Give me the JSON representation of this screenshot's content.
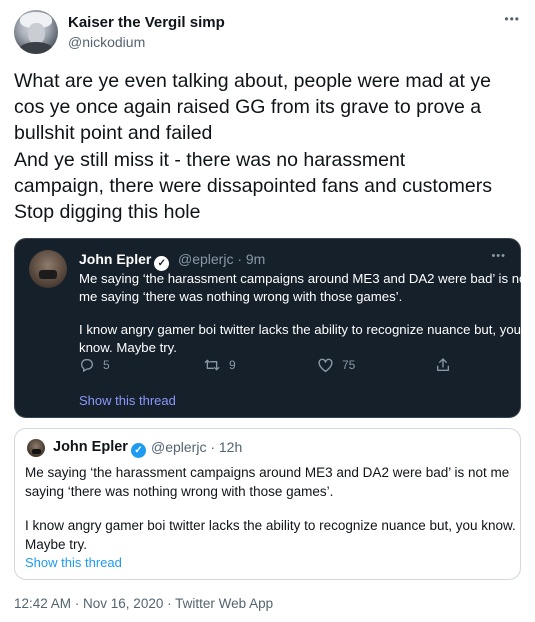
{
  "author": {
    "display_name": "Kaiser the Vergil simp",
    "handle": "@nickodium",
    "more_icon": "more-horizontal-icon"
  },
  "tweet": {
    "lines": [
      "What are ye even talking about, people were mad at ye",
      "cos ye once again raised GG from its grave to prove a",
      "bullshit point and failed",
      "And ye still miss it - there was no harassment",
      "campaign, there were dissapointed fans and customers",
      "Stop digging this hole"
    ]
  },
  "dark_quote": {
    "display_name": "John Epler",
    "meta": "@eplerjc · 9m",
    "paragraph1": [
      "Me saying ‘the harassment campaigns around ME3 and DA2 were bad’ is not",
      "me saying ‘there was nothing wrong with those games’."
    ],
    "paragraph2": [
      "I know angry gamer boi twitter lacks the ability to recognize nuance but, you",
      "know. Maybe try."
    ],
    "replies": "5",
    "retweets": "9",
    "likes": "75",
    "show_thread": "Show this thread"
  },
  "light_quote": {
    "display_name": "John Epler",
    "meta": "@eplerjc · 12h",
    "paragraph1": [
      "Me saying ‘the harassment campaigns around ME3 and DA2 were bad’ is not me",
      "saying ‘there was nothing wrong with those games’."
    ],
    "paragraph2": [
      "I know angry gamer boi twitter lacks the ability to recognize nuance but, you know.",
      "Maybe try."
    ],
    "show_thread": "Show this thread"
  },
  "footer": {
    "timestamp": "12:42 AM · Nov 16, 2020 · Twitter Web App"
  },
  "colors": {
    "accent": "#1d9bf0",
    "dark_bg": "#15202b",
    "dark_link": "#8b98f9",
    "muted": "#536471"
  }
}
